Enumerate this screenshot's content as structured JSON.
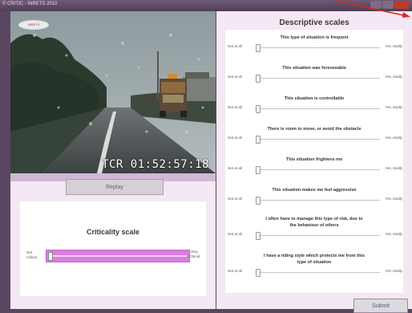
{
  "window": {
    "title": "© CRITIC - INRETS 2010"
  },
  "video": {
    "logo": "INRETS",
    "timecode": "TCR 01:52:57:18"
  },
  "left": {
    "replay_label": "Replay",
    "criticality": {
      "title": "Criticality scale",
      "min_label": "Not critical",
      "max_label": "Very Critical",
      "value": 0
    }
  },
  "right": {
    "title": "Descriptive scales",
    "items": [
      {
        "question": "This type of situation is frequent",
        "min": "Not at all",
        "max": "Yes, totally",
        "value": 0
      },
      {
        "question": "This situation was foreseeable",
        "min": "Not at all",
        "max": "Yes, totally",
        "value": 0
      },
      {
        "question": "This situation is controllable",
        "min": "Not at all",
        "max": "Yes, totally",
        "value": 0
      },
      {
        "question": "There is room to move, or avoid the obstacle",
        "min": "Not at all",
        "max": "Yes, totally",
        "value": 0
      },
      {
        "question": "This situation frightens me",
        "min": "Not at all",
        "max": "Yes, totally",
        "value": 0
      },
      {
        "question": "This situation makes me feel aggressive",
        "min": "Not at all",
        "max": "Yes, totally",
        "value": 0
      },
      {
        "question": "I often have to manage this type of risk, due to the behaviour of others",
        "min": "Not at all",
        "max": "Yes, totally",
        "value": 0
      },
      {
        "question": "I have a riding style which protects me from this type of situation",
        "min": "Not at all",
        "max": "Yes, totally",
        "value": 0
      }
    ],
    "submit_label": "Submit"
  },
  "colors": {
    "accent": "#d97ede",
    "arrow": "#d6261e"
  }
}
